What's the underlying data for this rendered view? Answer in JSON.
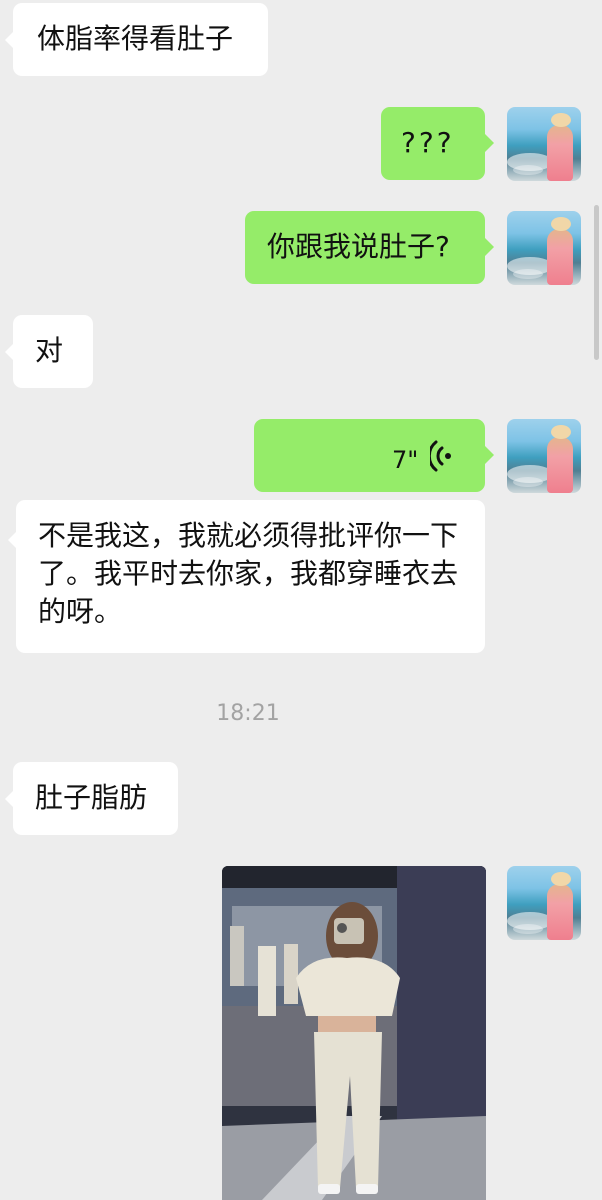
{
  "messages": [
    {
      "side": "in",
      "type": "text",
      "text": "体脂率得看肚子"
    },
    {
      "side": "out",
      "type": "text",
      "text": "???"
    },
    {
      "side": "out",
      "type": "text",
      "text": "你跟我说肚子?"
    },
    {
      "side": "in",
      "type": "text",
      "text": "对"
    },
    {
      "side": "out",
      "type": "voice",
      "duration": "7\"",
      "icon": "voice-wave-icon"
    },
    {
      "side": "in",
      "type": "text",
      "text": "不是我这，我就必须得批评你一下了。我平时去你家，我都穿睡衣去的呀。"
    },
    {
      "type": "timestamp",
      "text": "18:21"
    },
    {
      "side": "in",
      "type": "text",
      "text": "肚子脂肪"
    },
    {
      "side": "out",
      "type": "image",
      "subject": "mirror-selfie-photo"
    }
  ],
  "colors": {
    "background": "#ededed",
    "incoming_bubble": "#ffffff",
    "outgoing_bubble": "#95ec69",
    "timestamp": "#a3a3a3"
  }
}
